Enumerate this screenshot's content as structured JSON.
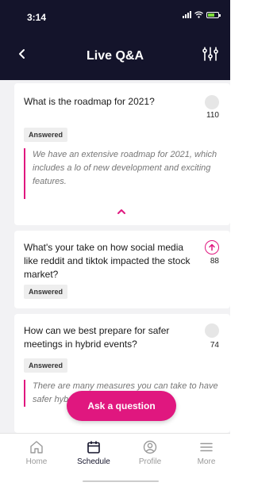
{
  "status": {
    "time": "3:14"
  },
  "header": {
    "title": "Live Q&A"
  },
  "questions": [
    {
      "text": "What is the roadmap for 2021?",
      "votes": "110",
      "badge": "Answered",
      "answer": "We have an extensive roadmap for 2021, which includes a lo of new development and exciting features."
    },
    {
      "text": "What's your take on how social media like reddit and tiktok impacted the stock market?",
      "votes": "88",
      "badge": "Answered"
    },
    {
      "text": "How can we best prepare for safer meetings in hybrid events?",
      "votes": "74",
      "badge": "Answered",
      "answer": "There are many measures you can take to have safer hybrid events. Chec..."
    }
  ],
  "ask_button": {
    "label": "Ask a question"
  },
  "tabs": [
    {
      "label": "Home",
      "icon": "home-icon"
    },
    {
      "label": "Schedule",
      "icon": "calendar-icon"
    },
    {
      "label": "Profile",
      "icon": "profile-icon"
    },
    {
      "label": "More",
      "icon": "menu-icon"
    }
  ],
  "colors": {
    "accent": "#e0177f",
    "header_bg": "#14142b",
    "battery": "#7cdc3a"
  }
}
